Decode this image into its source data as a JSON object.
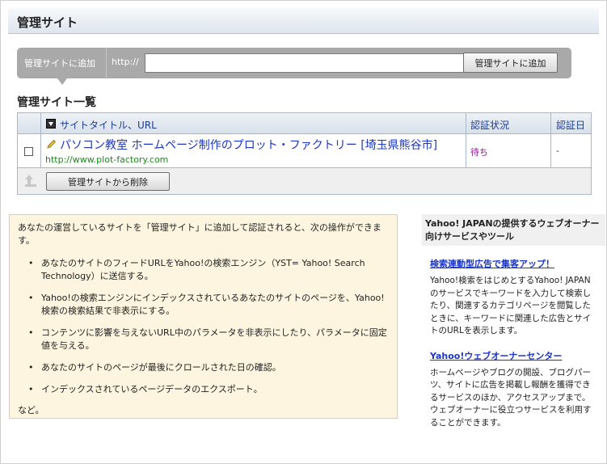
{
  "header": {
    "title": "管理サイト"
  },
  "add_bar": {
    "label": "管理サイトに追加",
    "prefix": "http://",
    "url_value": "",
    "button_label": "管理サイトに追加"
  },
  "list": {
    "title": "管理サイト一覧",
    "columns": {
      "site": "サイトタイトル、URL",
      "status": "認証状況",
      "date": "認証日"
    },
    "rows": [
      {
        "name": "パソコン教室 ホームページ制作のプロット・ファクトリー [埼玉県熊谷市]",
        "url": "http://www.plot-factory.com",
        "status": "待ち",
        "date": "-"
      }
    ],
    "delete_button": "管理サイトから削除"
  },
  "info": {
    "intro": "あなたの運営しているサイトを「管理サイト」に追加して認証されると、次の操作ができます。",
    "bullet": "•",
    "items": [
      "あなたのサイトのフィードURLをYahoo!の検索エンジン（YST= Yahoo! Search Technology）に送信する。",
      "Yahoo!の検索エンジンにインデックスされているあなたのサイトのページを、Yahoo!検索の検索結果で非表示にする。",
      "コンテンツに影響を与えないURL中のパラメータを非表示にしたり、パラメータに固定値を与える。",
      "あなたのサイトのページが最後にクロールされた日の確認。",
      "インデックスされているページデータのエクスポート。"
    ],
    "outro": "など。"
  },
  "sidebar": {
    "title": "Yahoo! JAPANの提供するウェブオーナー向けサービスやツール",
    "links": [
      {
        "label": "検索連動型広告で集客アップ！",
        "desc": "Yahoo!検索をはじめとするYahoo! JAPANのサービスでキーワードを入力して検索したり、関連するカテゴリページを閲覧したときに、キーワードに関連した広告とサイトのURLを表示します。"
      },
      {
        "label": "Yahoo!ウェブオーナーセンター",
        "desc": "ホームページやブログの開設、ブログパーツ、サイトに広告を掲載し報酬を獲得できるサービスのほか、アクセスアップまで。ウェブオーナーに役立つサービスを利用することができます。"
      }
    ]
  }
}
